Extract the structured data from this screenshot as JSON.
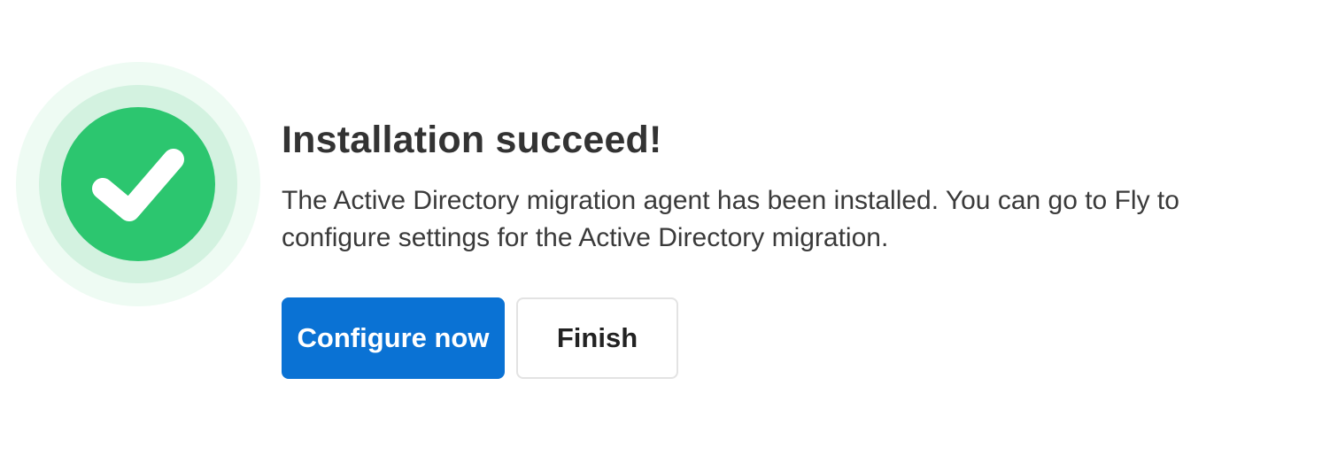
{
  "dialog": {
    "status_icon": "success-check-icon",
    "title": "Installation succeed!",
    "message": "The Active Directory migration agent has been installed. You can go to Fly to configure settings for the Active Directory migration.",
    "actions": {
      "configure_label": "Configure now",
      "finish_label": "Finish"
    }
  },
  "colors": {
    "success_green": "#2cc66f",
    "primary_blue": "#0a72d4"
  }
}
